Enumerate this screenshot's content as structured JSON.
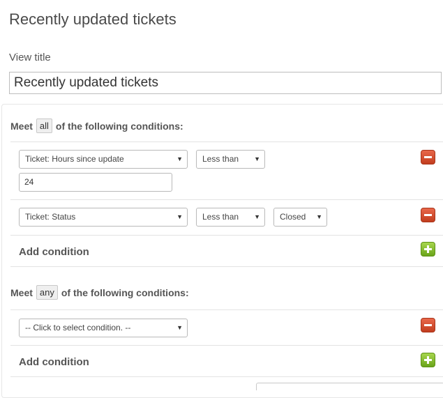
{
  "page": {
    "title": "Recently updated tickets"
  },
  "view_title": {
    "label": "View title",
    "value": "Recently updated tickets"
  },
  "group_all": {
    "prefix": "Meet",
    "mode": "all",
    "suffix": "of the following conditions:",
    "conditions": [
      {
        "field": "Ticket: Hours since update",
        "operator": "Less than",
        "value": "24"
      },
      {
        "field": "Ticket: Status",
        "operator": "Less than",
        "value": "Closed"
      }
    ],
    "add_label": "Add condition"
  },
  "group_any": {
    "prefix": "Meet",
    "mode": "any",
    "suffix": "of the following conditions:",
    "conditions": [
      {
        "field": "-- Click to select condition. --"
      }
    ],
    "add_label": "Add condition"
  },
  "icons": {
    "remove": "minus-icon",
    "add": "plus-icon",
    "dropdown": "caret-down-icon"
  },
  "colors": {
    "remove": "#d4502f",
    "add": "#8cc63f",
    "text": "#555555"
  }
}
